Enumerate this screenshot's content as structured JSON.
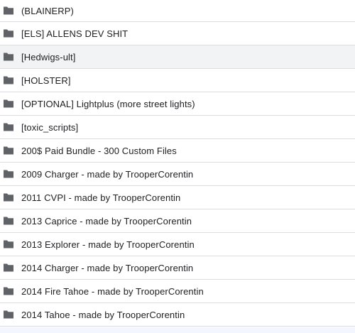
{
  "folder_icon_color": "#5f6368",
  "hover_row_index": 2,
  "items": [
    {
      "name": "(BLAINERP)"
    },
    {
      "name": "[ELS] ALLENS DEV SHIT"
    },
    {
      "name": "[Hedwigs-ult]"
    },
    {
      "name": "[HOLSTER]"
    },
    {
      "name": "[OPTIONAL] Lightplus (more street lights)"
    },
    {
      "name": "[toxic_scripts]"
    },
    {
      "name": "200$ Paid Bundle - 300 Custom Files"
    },
    {
      "name": "2009 Charger - made by TrooperCorentin"
    },
    {
      "name": "2011 CVPI - made by TrooperCorentin"
    },
    {
      "name": "2013 Caprice - made by TrooperCorentin"
    },
    {
      "name": "2013 Explorer - made by TrooperCorentin"
    },
    {
      "name": "2014 Charger - made by TrooperCorentin"
    },
    {
      "name": "2014 Fire Tahoe - made by TrooperCorentin"
    },
    {
      "name": "2014 Tahoe - made by TrooperCorentin"
    }
  ]
}
